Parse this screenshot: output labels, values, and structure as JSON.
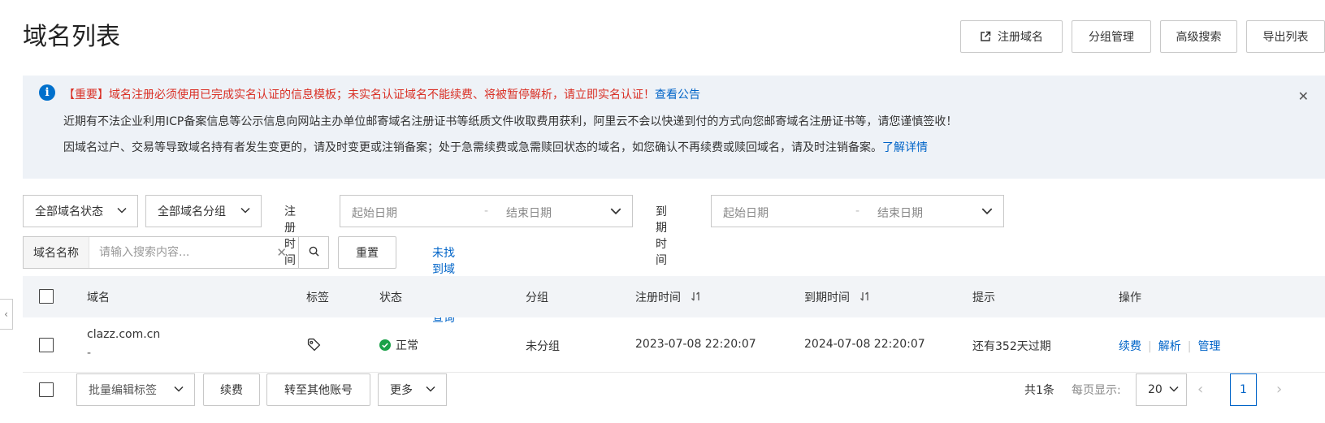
{
  "page_title": "域名列表",
  "top_actions": {
    "register": "注册域名",
    "group_manage": "分组管理",
    "advanced_search": "高级搜索",
    "export": "导出列表"
  },
  "notice": {
    "line1_alert": "【重要】域名注册必须使用已完成实名认证的信息模板；未实名认证域名不能续费、将被暂停解析，请立即实名认证！",
    "line1_link": "查看公告",
    "line2": "近期有不法企业利用ICP备案信息等公示信息向网站主办单位邮寄域名注册证书等纸质文件收取费用获利，阿里云不会以快递到付的方式向您邮寄域名注册证书等，请您谨慎签收！",
    "line3": "因域名过户、交易等导致域名持有者发生变更的，请及时变更或注销备案；处于急需续费或急需赎回状态的域名，如您确认不再续费或赎回域名，请及时注销备案。",
    "line3_link": "了解详情"
  },
  "filters": {
    "status_select": "全部域名状态",
    "group_select": "全部域名分组",
    "reg_time_label": "注册时间",
    "exp_time_label": "到期时间",
    "start_placeholder": "起始日期",
    "end_placeholder": "结束日期",
    "dash": "-"
  },
  "search": {
    "prefix": "域名名称",
    "placeholder": "请输入搜索内容...",
    "reset": "重置",
    "not_found_link": "未找到域名？点此查询"
  },
  "table": {
    "headers": {
      "domain": "域名",
      "tag": "标签",
      "status": "状态",
      "group": "分组",
      "reg_time": "注册时间",
      "exp_time": "到期时间",
      "hint": "提示",
      "ops": "操作"
    },
    "rows": [
      {
        "domain": "clazz.com.cn",
        "sub": "-",
        "status": "正常",
        "group": "未分组",
        "reg_time": "2023-07-08 22:20:07",
        "exp_time": "2024-07-08 22:20:07",
        "hint": "还有352天过期",
        "op_renew": "续费",
        "op_dns": "解析",
        "op_manage": "管理"
      }
    ]
  },
  "bottom": {
    "batch_tags": "批量编辑标签",
    "renew": "续费",
    "transfer": "转至其他账号",
    "more": "更多",
    "total": "共1条",
    "per_page_label": "每页显示:",
    "per_page": "20",
    "current_page": "1"
  },
  "colors": {
    "link": "#0064c8",
    "alert": "#d93026",
    "success": "#1aa148",
    "notice_bg": "#eef2f7"
  }
}
